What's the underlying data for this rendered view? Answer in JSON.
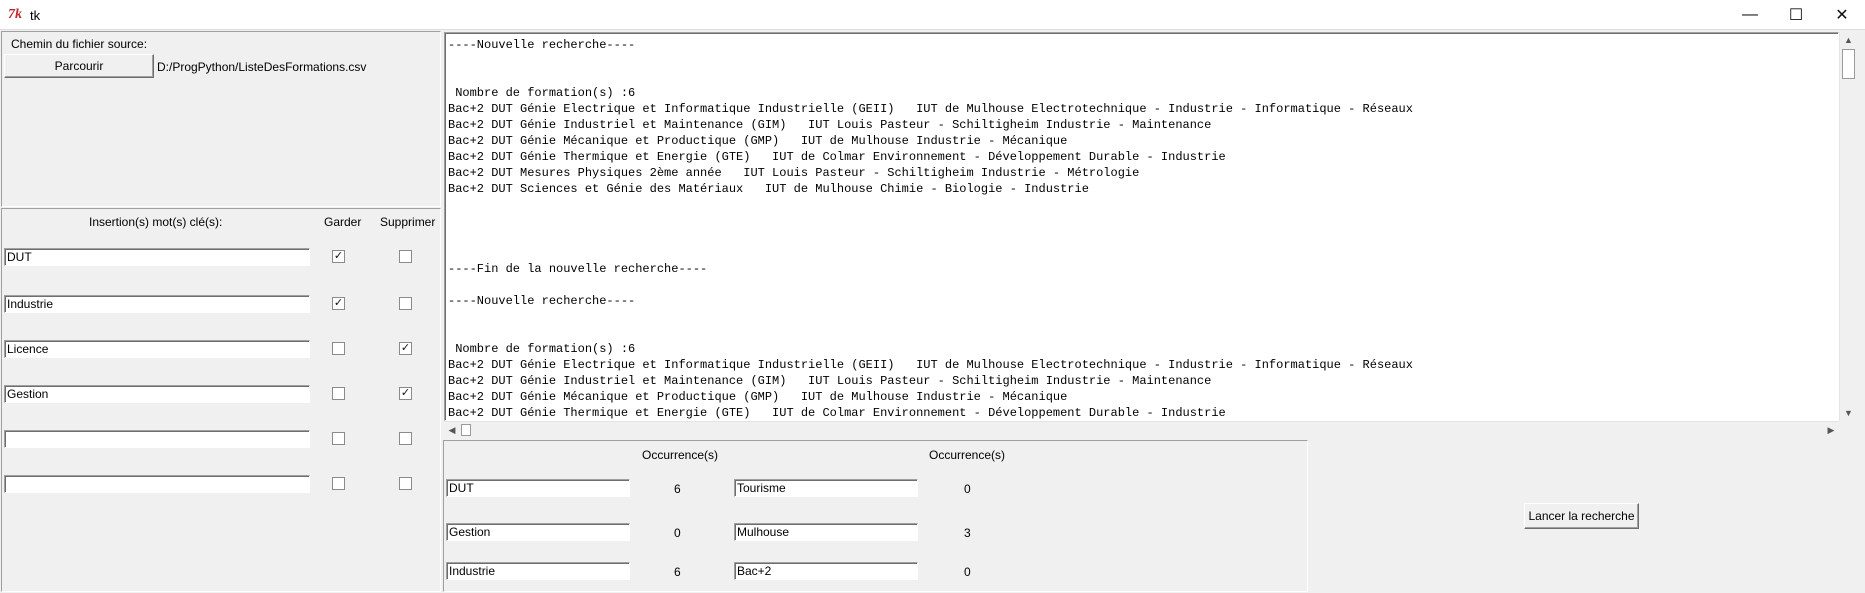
{
  "window": {
    "title": "tk",
    "icon_label": "7k",
    "minimize_glyph": "—",
    "maximize_glyph": "☐",
    "close_glyph": "✕"
  },
  "source": {
    "label": "Chemin du fichier source:",
    "browse_button": "Parcourir",
    "path": "D:/ProgPython/ListeDesFormations.csv"
  },
  "keywords": {
    "header": "Insertion(s) mot(s) clé(s):",
    "keep_header": "Garder",
    "delete_header": "Supprimer",
    "rows": [
      {
        "value": "DUT",
        "keep": true,
        "delete": false
      },
      {
        "value": "Industrie",
        "keep": true,
        "delete": false
      },
      {
        "value": "Licence",
        "keep": false,
        "delete": true
      },
      {
        "value": "Gestion",
        "keep": false,
        "delete": true
      },
      {
        "value": "",
        "keep": false,
        "delete": false
      },
      {
        "value": "",
        "keep": false,
        "delete": false
      }
    ]
  },
  "results": {
    "lines": [
      "----Nouvelle recherche----",
      "",
      "",
      " Nombre de formation(s) :6",
      "Bac+2 DUT Génie Electrique et Informatique Industrielle (GEII)   IUT de Mulhouse Electrotechnique - Industrie - Informatique - Réseaux",
      "Bac+2 DUT Génie Industriel et Maintenance (GIM)   IUT Louis Pasteur - Schiltigheim Industrie - Maintenance",
      "Bac+2 DUT Génie Mécanique et Productique (GMP)   IUT de Mulhouse Industrie - Mécanique",
      "Bac+2 DUT Génie Thermique et Energie (GTE)   IUT de Colmar Environnement - Développement Durable - Industrie",
      "Bac+2 DUT Mesures Physiques 2ème année   IUT Louis Pasteur - Schiltigheim Industrie - Métrologie",
      "Bac+2 DUT Sciences et Génie des Matériaux   IUT de Mulhouse Chimie - Biologie - Industrie",
      "",
      "",
      "",
      "",
      "----Fin de la nouvelle recherche----",
      "",
      "----Nouvelle recherche----",
      "",
      "",
      " Nombre de formation(s) :6",
      "Bac+2 DUT Génie Electrique et Informatique Industrielle (GEII)   IUT de Mulhouse Electrotechnique - Industrie - Informatique - Réseaux",
      "Bac+2 DUT Génie Industriel et Maintenance (GIM)   IUT Louis Pasteur - Schiltigheim Industrie - Maintenance",
      "Bac+2 DUT Génie Mécanique et Productique (GMP)   IUT de Mulhouse Industrie - Mécanique",
      "Bac+2 DUT Génie Thermique et Energie (GTE)   IUT de Colmar Environnement - Développement Durable - Industrie"
    ]
  },
  "occurrences": {
    "header": "Occurrence(s)",
    "left": [
      {
        "word": "DUT",
        "count": "6"
      },
      {
        "word": "Gestion",
        "count": "0"
      },
      {
        "word": "Industrie",
        "count": "6"
      }
    ],
    "right": [
      {
        "word": "Tourisme",
        "count": "0"
      },
      {
        "word": "Mulhouse",
        "count": "3"
      },
      {
        "word": "Bac+2",
        "count": "0"
      }
    ]
  },
  "actions": {
    "search_button": "Lancer la recherche"
  }
}
